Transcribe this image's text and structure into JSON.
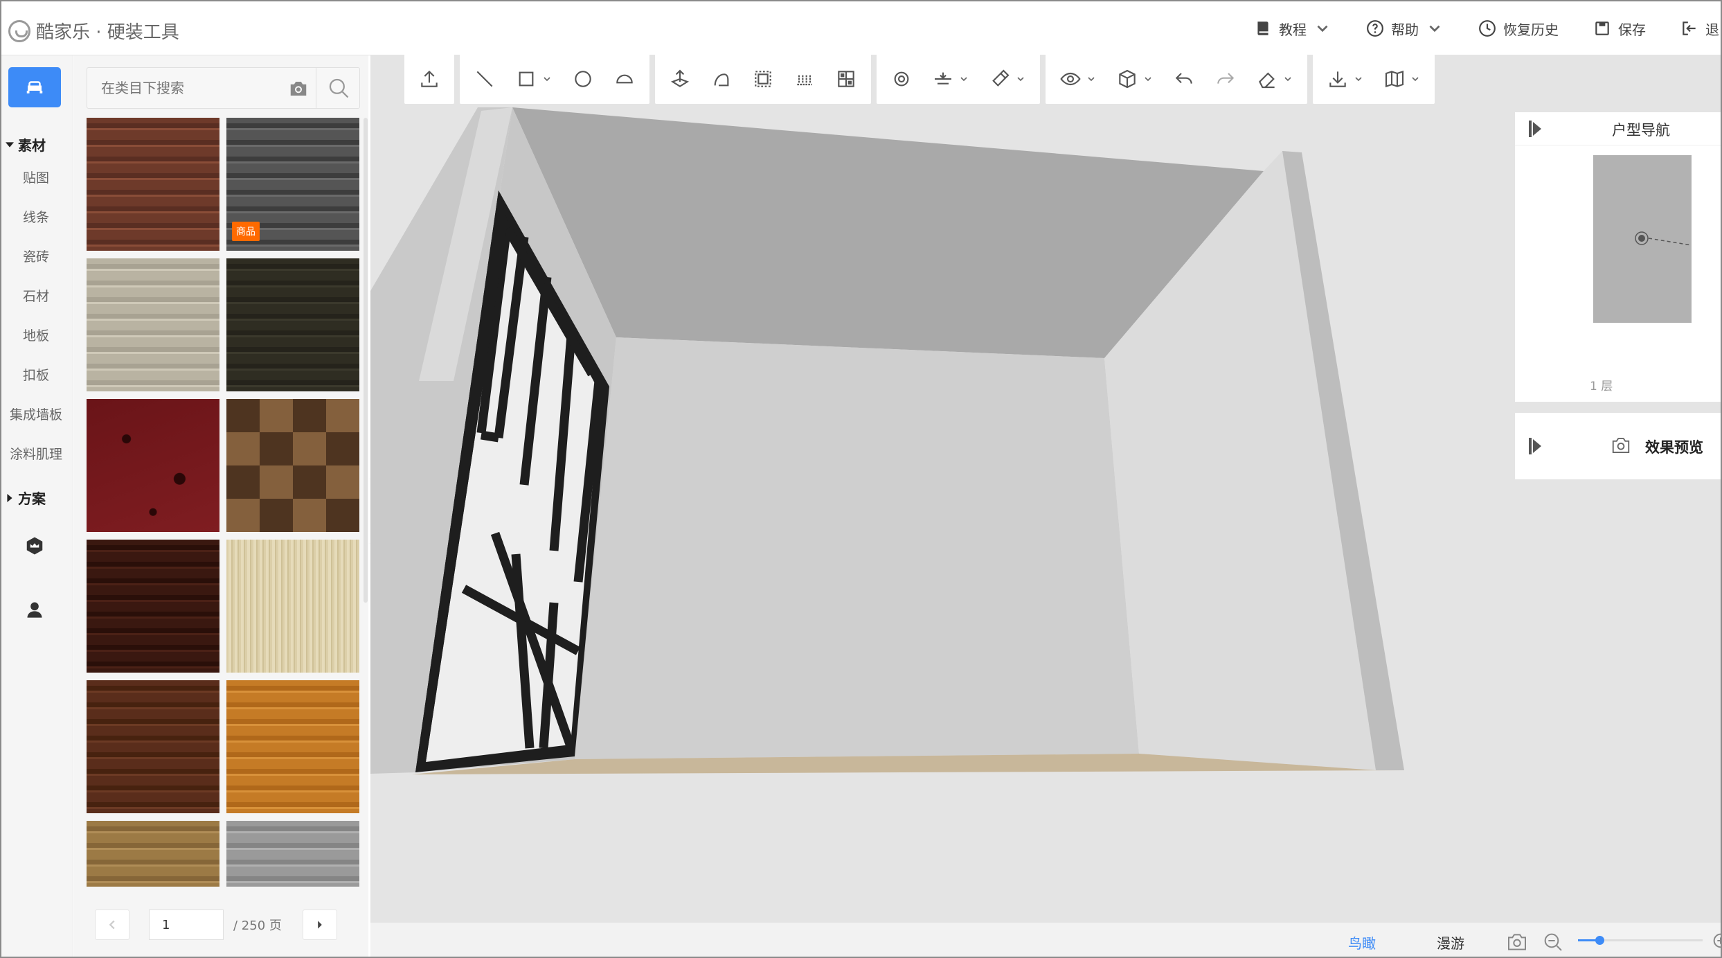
{
  "app": {
    "title": "酷家乐 · 硬装工具"
  },
  "header": {
    "actions": [
      {
        "name": "tutorial",
        "label": "教程",
        "has_caret": true
      },
      {
        "name": "help",
        "label": "帮助",
        "has_caret": true
      },
      {
        "name": "restore-history",
        "label": "恢复历史",
        "has_caret": false
      },
      {
        "name": "save",
        "label": "保存",
        "has_caret": false
      },
      {
        "name": "exit",
        "label": "退出",
        "has_caret": false
      }
    ]
  },
  "leftnav": {
    "section_material": "素材",
    "items": [
      "贴图",
      "线条",
      "瓷砖",
      "石材",
      "地板",
      "扣板",
      "集成墙板",
      "涂料肌理"
    ],
    "section_plan": "方案"
  },
  "panel": {
    "search_placeholder": "在类目下搜索",
    "tiles": [
      {
        "name": "wood-red-brown",
        "badge": ""
      },
      {
        "name": "wood-gray",
        "badge": "商品"
      },
      {
        "name": "wood-light-beige",
        "badge": ""
      },
      {
        "name": "wood-dark-green",
        "badge": ""
      },
      {
        "name": "marble-dark-red",
        "badge": ""
      },
      {
        "name": "parquet-brown",
        "badge": ""
      },
      {
        "name": "wood-dark-red",
        "badge": ""
      },
      {
        "name": "cork-cream",
        "badge": ""
      },
      {
        "name": "wood-chestnut",
        "badge": ""
      },
      {
        "name": "wood-orange",
        "badge": ""
      },
      {
        "name": "wood-golden",
        "badge": ""
      },
      {
        "name": "wood-silver",
        "badge": ""
      }
    ],
    "pager": {
      "current": "1",
      "total_label": "/ 250 页"
    }
  },
  "right": {
    "nav_title": "户型导航",
    "floor_label": "1 层",
    "preview_title": "效果预览"
  },
  "bottom": {
    "tab_birdseye": "鸟瞰",
    "tab_roam": "漫游",
    "zoom_fraction": 0.17
  },
  "colors": {
    "accent": "#3d8bf7",
    "badge": "#ff6a00"
  }
}
